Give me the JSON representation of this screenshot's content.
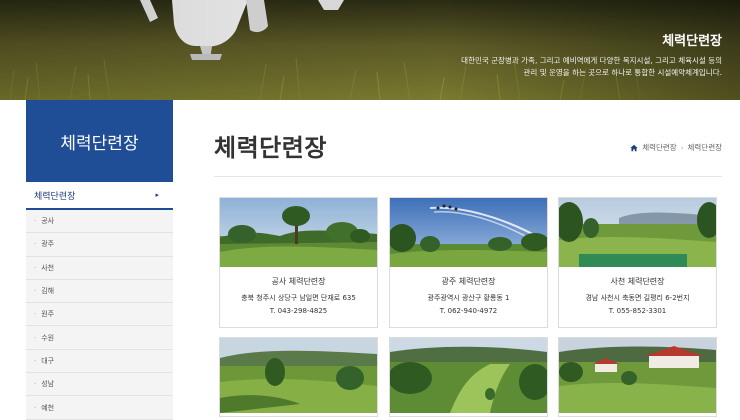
{
  "hero": {
    "title": "체력단련장",
    "desc_line1": "대한민국 군장병과 가족, 그리고 예비역에게 다양한 복지시설, 그리고 체육시설 등의",
    "desc_line2": "관리 및 운영을 하는 곳으로 하나로 통합한 시설예약체계입니다."
  },
  "sidebar": {
    "heading": "체력단련장",
    "active_item": "체력단련장",
    "active_arrow": "▸",
    "sub_items": [
      "공사",
      "광주",
      "사천",
      "김해",
      "원주",
      "수원",
      "대구",
      "성남",
      "예천"
    ]
  },
  "main": {
    "title": "체력단련장",
    "breadcrumb": [
      "체력단련장",
      "체력단련장"
    ],
    "cards": [
      {
        "name": "공사 체력단련장",
        "address": "충북 청주시 상당구 남일면 단재로 635",
        "tel": "T. 043-298-4825"
      },
      {
        "name": "광주 체력단련장",
        "address": "광주광역시 광산구 황룡동 1",
        "tel": "T. 062-940-4972"
      },
      {
        "name": "사천 체력단련장",
        "address": "경남 사천시 축동면 길평리 6-2번지",
        "tel": "T. 055-852-3301"
      }
    ]
  },
  "colors": {
    "accent": "#1f4e96",
    "title_text": "#333333"
  }
}
